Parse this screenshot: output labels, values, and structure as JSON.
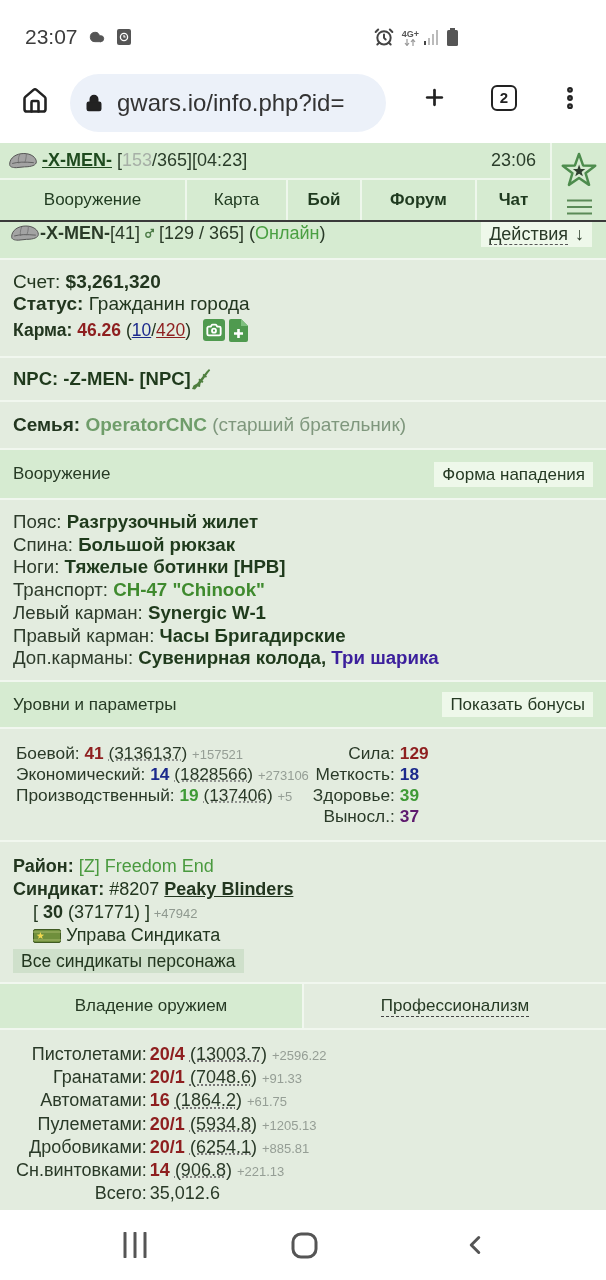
{
  "status_bar": {
    "time": "23:07",
    "network": "4G+"
  },
  "browser": {
    "url": "gwars.io/info.php?id=",
    "tab_count": "2"
  },
  "top_bar": {
    "player": "-X-MEN-",
    "stats": [
      {
        "text": " [",
        "kind": "text"
      },
      {
        "text": "153",
        "kind": "faded"
      },
      {
        "text": "/365][04:23]",
        "kind": "text"
      }
    ],
    "clock": "23:06"
  },
  "nav": [
    {
      "label": "Вооружение",
      "bold": false
    },
    {
      "label": "Карта",
      "bold": false
    },
    {
      "label": "Бой",
      "bold": true
    },
    {
      "label": "Форум",
      "bold": true
    },
    {
      "label": "Чат",
      "bold": true
    }
  ],
  "profile": {
    "name": [
      {
        "text": "-X-MEN-",
        "kind": "strong"
      },
      {
        "text": "[41]",
        "kind": "text"
      }
    ],
    "status": [
      {
        "text": "[129 / 365] (",
        "kind": "text"
      },
      {
        "text": "Онлайн",
        "kind": "text",
        "color": "#4a9f42"
      },
      {
        "text": ")",
        "kind": "text"
      }
    ],
    "actions": {
      "label": "Действия",
      "arrow": "↓"
    }
  },
  "account": {
    "balance": [
      {
        "text": "Счет: ",
        "kind": "text"
      },
      {
        "text": "$3,261,320",
        "kind": "strong"
      }
    ],
    "status": [
      {
        "text": "Статус: ",
        "kind": "strong"
      },
      {
        "text": "Гражданин города",
        "kind": "text"
      }
    ],
    "karma": [
      {
        "text": "Карма: ",
        "kind": "strong"
      },
      {
        "text": "46.26",
        "kind": "strong",
        "color": "#8e1f1f"
      },
      {
        "text": " (",
        "kind": "text"
      },
      {
        "text": "10",
        "kind": "link",
        "color": "#1c2a8c"
      },
      {
        "text": "/",
        "kind": "text"
      },
      {
        "text": "420",
        "kind": "link",
        "color": "#8e1f1f"
      },
      {
        "text": ")",
        "kind": "text"
      }
    ]
  },
  "npc": {
    "text": "NPC: -Z-MEN- [NPC]"
  },
  "family": [
    {
      "text": "Семья: ",
      "kind": "strong"
    },
    {
      "text": "OperatorCNC",
      "kind": "strong-bare-link",
      "color": "#6f9d6a"
    },
    {
      "text": " (старший брательник)",
      "kind": "text",
      "color": "#7f977d"
    }
  ],
  "equipment": {
    "title": "Вооружение",
    "button": "Форма нападения",
    "slots": [
      {
        "slot": "Пояс:",
        "items": [
          {
            "text": "Разгрузочный жилет",
            "color": "#1f3a1c"
          }
        ]
      },
      {
        "slot": "Спина:",
        "items": [
          {
            "text": "Большой рюкзак",
            "color": "#1f3a1c"
          }
        ]
      },
      {
        "slot": "Ноги:",
        "items": [
          {
            "text": "Тяжелые ботинки [HPB]",
            "color": "#1f3a1c"
          }
        ]
      },
      {
        "slot": "Транспорт:",
        "items": [
          {
            "text": "CH-47 \"Chinook\"",
            "color": "#3f8a2e"
          }
        ]
      },
      {
        "slot": "Левый карман:",
        "items": [
          {
            "text": "Synergic W-1",
            "color": "#1f3a1c"
          }
        ]
      },
      {
        "slot": "Правый карман:",
        "items": [
          {
            "text": "Часы Бригадирские",
            "color": "#1f3a1c"
          }
        ]
      },
      {
        "slot": "Доп.карманы:",
        "items": [
          {
            "text": "Сувенирная колода,",
            "color": "#1f3a1c"
          },
          {
            "text": "Три шарика",
            "color": "#3b1f9c"
          }
        ]
      }
    ]
  },
  "levels": {
    "title": "Уровни и параметры",
    "button": "Показать бонусы",
    "skills": [
      {
        "label": "Боевой:",
        "level": "41",
        "color": "#8e1f1f",
        "exp": "(3136137)",
        "bonus": "+157521"
      },
      {
        "label": "Экономический:",
        "level": "14",
        "color": "#1c2a8c",
        "exp": "(1828566)",
        "bonus": "+273106"
      },
      {
        "label": "Производственный:",
        "level": "19",
        "color": "#3f9a36",
        "exp": "(137406)",
        "bonus": "+5"
      }
    ],
    "stats": [
      {
        "label": "Сила:",
        "value": "129",
        "color": "#8e1f1f"
      },
      {
        "label": "Меткость:",
        "value": "18",
        "color": "#1c2a8c"
      },
      {
        "label": "Здоровье:",
        "value": "39",
        "color": "#3f9a36"
      },
      {
        "label": "Выносл.:",
        "value": "37",
        "color": "#5e1a6e"
      }
    ]
  },
  "syndicate": {
    "district": [
      {
        "text": "Район: ",
        "kind": "strong"
      },
      {
        "text": "[Z] Freedom End",
        "kind": "bare-link",
        "color": "#4a9a3f"
      }
    ],
    "name": [
      {
        "text": "Синдикат: ",
        "kind": "strong"
      },
      {
        "text": "#8207 ",
        "kind": "text"
      },
      {
        "text": "Peaky Blinders",
        "kind": "strong-link"
      }
    ],
    "rank": [
      {
        "text": "[ ",
        "kind": "text"
      },
      {
        "text": "30",
        "kind": "strong"
      },
      {
        "text": " (371771) ]",
        "kind": "text"
      },
      {
        "text": " +47942",
        "kind": "note"
      }
    ],
    "role": "Управа Синдиката",
    "button": "Все синдикаты персонажа"
  },
  "weapon_tabs": [
    {
      "label": "Владение оружием",
      "selected": true
    },
    {
      "label": "Профессионализм",
      "selected": false
    }
  ],
  "weapon_skills": [
    {
      "label": "Пистолетами:",
      "level": "20/4",
      "exp": "(13003.7)",
      "bonus": "+2596.22"
    },
    {
      "label": "Гранатами:",
      "level": "20/1",
      "exp": "(7048.6)",
      "bonus": "+91.33"
    },
    {
      "label": "Автоматами:",
      "level": "16",
      "exp": "(1864.2)",
      "bonus": "+61.75"
    },
    {
      "label": "Пулеметами:",
      "level": "20/1",
      "exp": "(5934.8)",
      "bonus": "+1205.13"
    },
    {
      "label": "Дробовиками:",
      "level": "20/1",
      "exp": "(6254.1)",
      "bonus": "+885.81"
    },
    {
      "label": "Сн.винтовками:",
      "level": "14",
      "exp": "(906.8)",
      "bonus": "+221.13"
    }
  ],
  "total": {
    "label": "Всего:",
    "value": "35,012.6"
  }
}
